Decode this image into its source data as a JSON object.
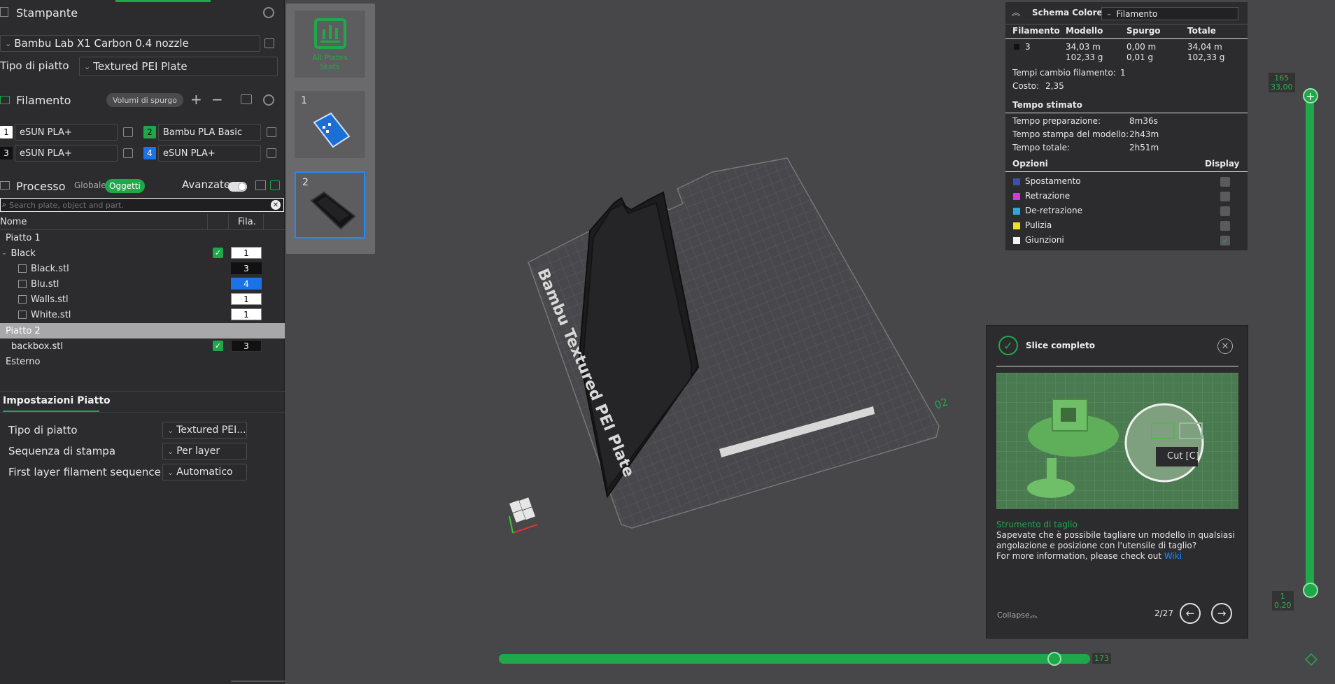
{
  "printer": {
    "section_title": "Stampante",
    "model": "Bambu Lab X1 Carbon 0.4 nozzle",
    "plate_type_label": "Tipo di piatto",
    "plate_type_value": "Textured PEI Plate"
  },
  "filament": {
    "section_title": "Filamento",
    "purge_button": "Volumi di spurgo",
    "slots": [
      {
        "num": "1",
        "name": "eSUN PLA+",
        "color": "#ffffff",
        "text_color": "#000000"
      },
      {
        "num": "2",
        "name": "Bambu PLA Basic",
        "color": "#1fa84a",
        "text_color": "#000000"
      },
      {
        "num": "3",
        "name": "eSUN PLA+",
        "color": "#111111",
        "text_color": "#ffffff"
      },
      {
        "num": "4",
        "name": "eSUN PLA+",
        "color": "#1a73e8",
        "text_color": "#ffffff"
      }
    ]
  },
  "process": {
    "section_title": "Processo",
    "tab_global": "Globale",
    "tab_objects": "Oggetti",
    "advanced_label": "Avanzate",
    "search_placeholder": "Search plate, object and part.",
    "col_name": "Nome",
    "col_fila": "Fila."
  },
  "tree": {
    "plate1": "Piatto 1",
    "black_group": "Black",
    "black_group_fil": "1",
    "parts": [
      {
        "name": "Black.stl",
        "fil": "3",
        "bg": "#111111",
        "fg": "#ffffff"
      },
      {
        "name": "Blu.stl",
        "fil": "4",
        "bg": "#1a73e8",
        "fg": "#ffffff"
      },
      {
        "name": "Walls.stl",
        "fil": "1",
        "bg": "#ffffff",
        "fg": "#000000"
      },
      {
        "name": "White.stl",
        "fil": "1",
        "bg": "#ffffff",
        "fg": "#000000"
      }
    ],
    "plate2": "Piatto 2",
    "backbox": "backbox.stl",
    "backbox_fil": "3",
    "external": "Esterno"
  },
  "plate_settings": {
    "tab": "Impostazioni Piatto",
    "rows": [
      {
        "label": "Tipo di piatto",
        "value": "Textured PEI..."
      },
      {
        "label": "Sequenza di stampa",
        "value": "Per layer"
      },
      {
        "label": "First layer filament sequence",
        "value": "Automatico"
      }
    ]
  },
  "plates_panel": {
    "all_stats_line1": "All Plates",
    "all_stats_line2": "Stats",
    "plate1_num": "1",
    "plate2_num": "2"
  },
  "bed": {
    "label": "Bambu Textured PEI Plate",
    "plate_num": "02"
  },
  "stats": {
    "title": "Schema Colore",
    "dropdown": "Filamento",
    "headers": [
      "Filamento",
      "Modello",
      "Spurgo",
      "Totale"
    ],
    "row": {
      "fil": "3",
      "model_m": "34,03 m",
      "model_g": "102,33 g",
      "purge_m": "0,00 m",
      "purge_g": "0,01 g",
      "total_m": "34,04 m",
      "total_g": "102,33 g"
    },
    "changes_label": "Tempi cambio filamento:",
    "changes_value": "1",
    "cost_label": "Costo:",
    "cost_value": "2,35",
    "time_title": "Tempo stimato",
    "times": [
      {
        "label": "Tempo preparazione:",
        "value": "8m36s"
      },
      {
        "label": "Tempo stampa del modello:",
        "value": "2h43m"
      },
      {
        "label": "Tempo totale:",
        "value": "2h51m"
      }
    ],
    "options_title": "Opzioni",
    "display_title": "Display",
    "options": [
      {
        "label": "Spostamento",
        "color": "#3a4fb0",
        "checked": false
      },
      {
        "label": "Retrazione",
        "color": "#d63ad6",
        "checked": false
      },
      {
        "label": "De-retrazione",
        "color": "#2aa8d8",
        "checked": false
      },
      {
        "label": "Pulizia",
        "color": "#f0e020",
        "checked": false
      },
      {
        "label": "Giunzioni",
        "color": "#f2f2f2",
        "checked": true
      }
    ]
  },
  "notice": {
    "title": "Slice completo",
    "cut_label": "Cut [C]",
    "tip_title": "Strumento di taglio",
    "tip_text": "Sapevate che è possibile tagliare un modello in qualsiasi angolazione e posizione con l'utensile di taglio?",
    "more_text": "For more information, please check out",
    "wiki": "Wiki",
    "collapse": "Collapse",
    "pager": "2/27"
  },
  "layer_slider": {
    "top_layer": "165",
    "top_height": "33,00",
    "bottom_layer": "1",
    "bottom_height": "0,20"
  },
  "move_slider": {
    "value": "173",
    "fraction": 0.94
  }
}
